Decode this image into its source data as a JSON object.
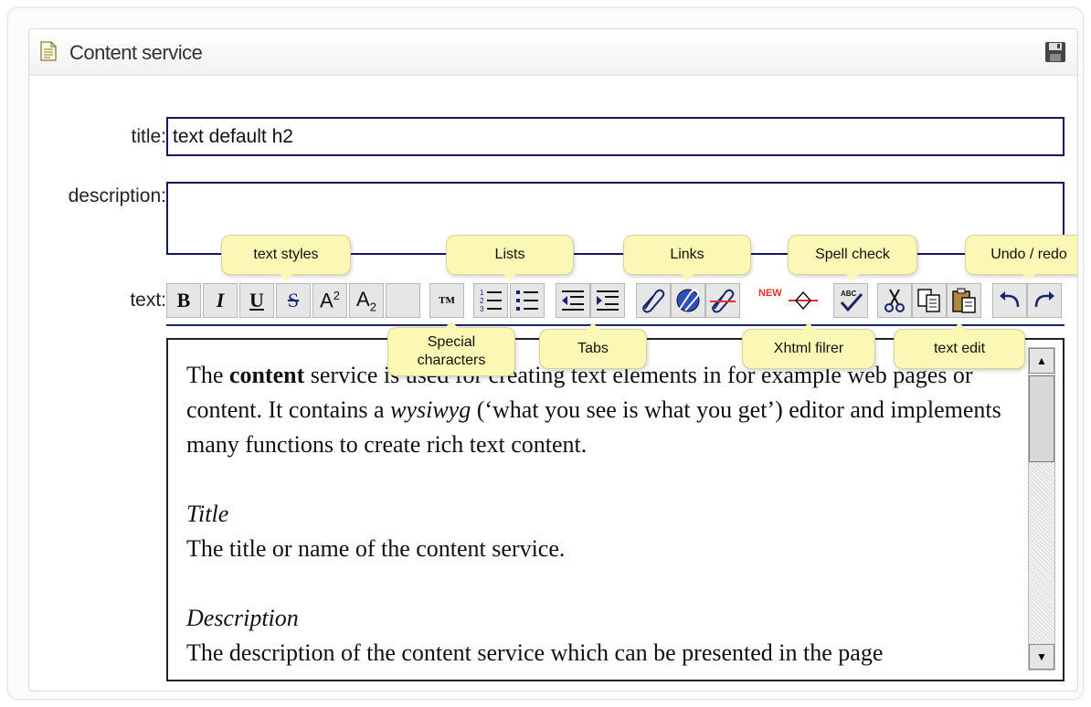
{
  "panel": {
    "title": "Content service",
    "doc_icon": "document-icon",
    "save_icon": "floppy-disk-icon"
  },
  "form": {
    "title_label": "title:",
    "title_value": "text default h2",
    "description_label": "description:",
    "description_value": "",
    "text_label": "text:"
  },
  "toolbar": {
    "bold": "B",
    "italic": "I",
    "underline": "U",
    "strike": "S",
    "superscript": "A",
    "superscript_sup": "2",
    "subscript": "A",
    "subscript_sub": "2",
    "special_chars": "TM",
    "new_badge": "NEW",
    "spell": "ABC"
  },
  "callouts": {
    "text_styles": "text styles",
    "lists": "Lists",
    "links": "Links",
    "spell_check": "Spell check",
    "undo_redo": "Undo / redo",
    "special_characters_1": "Special",
    "special_characters_2": "characters",
    "tabs": "Tabs",
    "xhtml_filter": "Xhtml filrer",
    "text_edit": "text edit"
  },
  "editor": {
    "p1_a": "The ",
    "p1_bold": "content",
    "p1_b": " service is used for creating text elements in for example web pages or content. It contains a ",
    "p1_italic": "wysiwyg",
    "p1_c": " (‘what you see is what you get’) editor and implements many functions to create rich text content.",
    "h_title": "Title",
    "p_title": "The title or name of the content service.",
    "h_desc": "Description",
    "p_desc": "The description of the content service which can be presented in the page"
  },
  "colors": {
    "accent": "#101a5a",
    "callout_bg": "#fbf7b4",
    "new_badge": "#e8302a"
  }
}
